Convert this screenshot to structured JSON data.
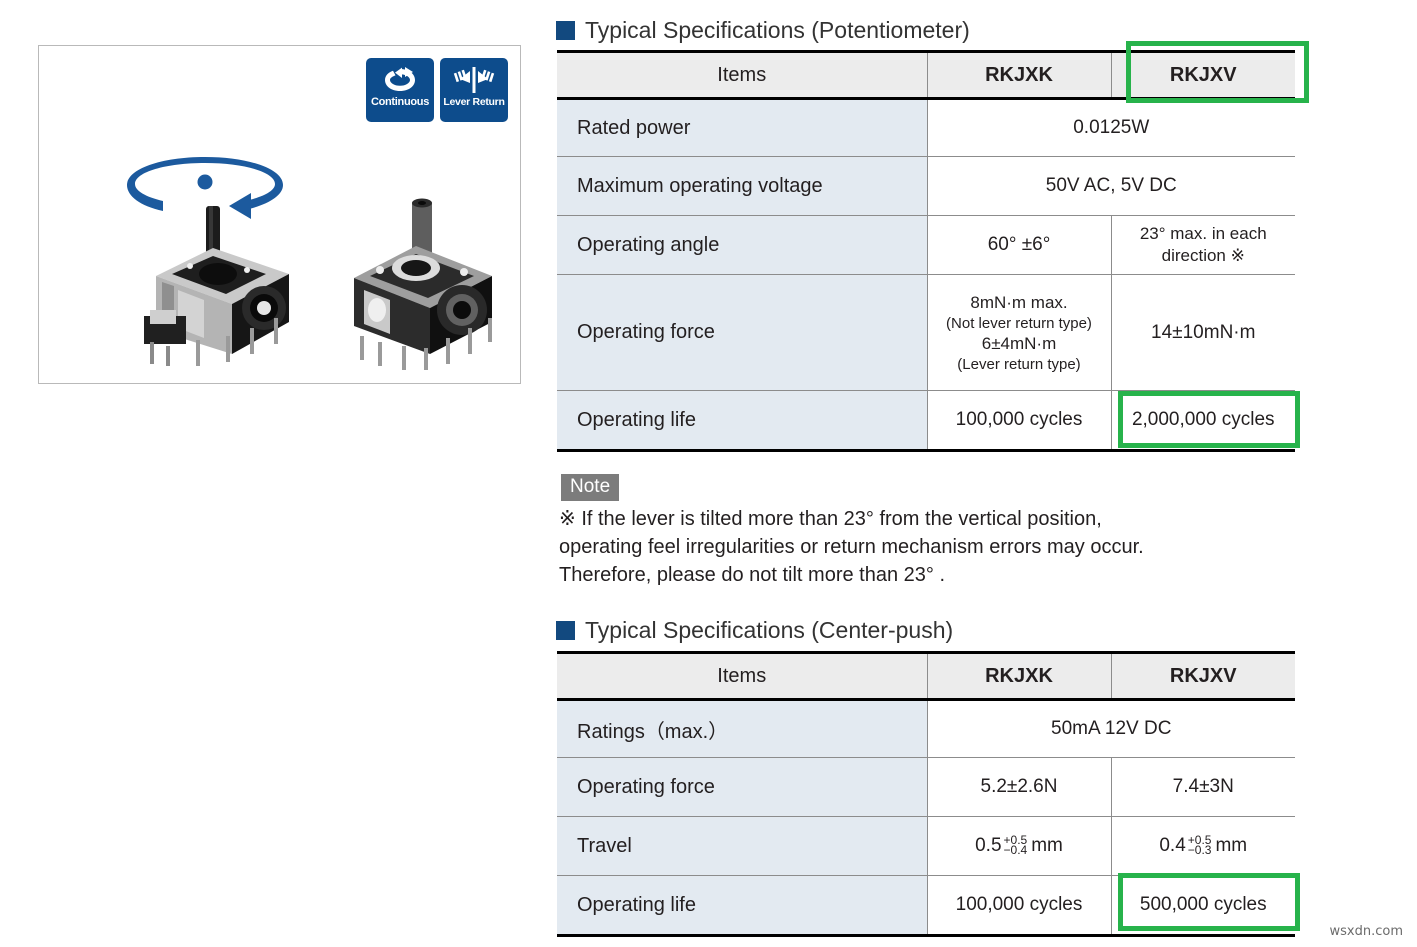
{
  "product_panel": {
    "badges": [
      {
        "icon": "continuous-rotation-icon",
        "label": "Continuous"
      },
      {
        "icon": "lever-return-icon",
        "label": "Lever Return"
      }
    ],
    "rotation_indicator": "rotation-arrow-icon",
    "photos": [
      {
        "name": "joystick-photo-left"
      },
      {
        "name": "joystick-photo-right"
      }
    ]
  },
  "colors": {
    "accent_blue": "#12497f",
    "badge_blue": "#0d4c8c",
    "highlight_green": "#27b34b",
    "item_cell_bg": "#e3eaf1",
    "header_bg": "#ececec",
    "note_tag_bg": "#7c7c7c"
  },
  "section1": {
    "title": "Typical Specifications (Potentiometer)",
    "columns": [
      "Items",
      "RKJXK",
      "RKJXV"
    ],
    "rows": [
      {
        "item": "Rated power",
        "span": true,
        "value": "0.0125W"
      },
      {
        "item": "Maximum operating voltage",
        "span": true,
        "value": "50V AC, 5V DC"
      },
      {
        "item": "Operating angle",
        "span": false,
        "rkjxk": "60° ±6°",
        "rkjxv_line1": "23° max. in each",
        "rkjxv_line2": "direction ※"
      },
      {
        "item": "Operating force",
        "span": false,
        "rkjxk_line1": "8mN·m max.",
        "rkjxk_line2": "(Not lever return type)",
        "rkjxk_line3": "6±4mN·m",
        "rkjxk_line4": "(Lever return type)",
        "rkjxv": "14±10mN·m"
      },
      {
        "item": "Operating life",
        "span": false,
        "rkjxk": "100,000 cycles",
        "rkjxv": "2,000,000 cycles",
        "rkjxv_highlighted": true
      }
    ],
    "highlighted_header": "RKJXV"
  },
  "note": {
    "tag": "Note",
    "line1": "※ If the lever is tilted more than 23° from the vertical position,",
    "line2": "operating feel irregularities or return mechanism errors may occur.",
    "line3": "Therefore, please do not tilt more than 23° ."
  },
  "section2": {
    "title": "Typical Specifications (Center-push)",
    "columns": [
      "Items",
      "RKJXK",
      "RKJXV"
    ],
    "rows": [
      {
        "item": "Ratings（max.）",
        "span": true,
        "value": "50mA 12V DC"
      },
      {
        "item": "Operating force",
        "span": false,
        "rkjxk": "5.2±2.6N",
        "rkjxv": "7.4±3N"
      },
      {
        "item": "Travel",
        "span": false,
        "rkjxk_base": "0.5",
        "rkjxk_plus": "+0.5",
        "rkjxk_minus": "−0.4",
        "rkjxk_unit": "mm",
        "rkjxv_base": "0.4",
        "rkjxv_plus": "+0.5",
        "rkjxv_minus": "−0.3",
        "rkjxv_unit": "mm"
      },
      {
        "item": "Operating life",
        "span": false,
        "rkjxk": "100,000 cycles",
        "rkjxv": "500,000 cycles",
        "rkjxv_highlighted": true
      }
    ]
  },
  "watermark": "wsxdn.com"
}
